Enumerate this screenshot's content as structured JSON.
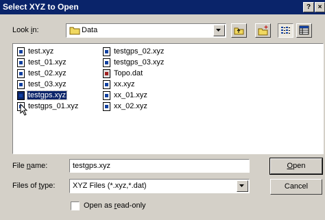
{
  "window": {
    "title": "Select XYZ to Open",
    "help_label": "?",
    "close_label": "×"
  },
  "lookin": {
    "label": "Look in:",
    "folder": "Data"
  },
  "toolbar": {
    "icons": [
      "up-folder-icon",
      "new-folder-icon",
      "list-view-icon",
      "details-view-icon"
    ]
  },
  "files": {
    "col1": [
      {
        "name": "test.xyz",
        "type": "xyz",
        "selected": false
      },
      {
        "name": "test_01.xyz",
        "type": "xyz",
        "selected": false
      },
      {
        "name": "test_02.xyz",
        "type": "xyz",
        "selected": false
      },
      {
        "name": "test_03.xyz",
        "type": "xyz",
        "selected": false
      },
      {
        "name": "testgps.xyz",
        "type": "xyz",
        "selected": true
      },
      {
        "name": "testgps_01.xyz",
        "type": "xyz",
        "selected": false
      }
    ],
    "col2": [
      {
        "name": "testgps_02.xyz",
        "type": "xyz",
        "selected": false
      },
      {
        "name": "testgps_03.xyz",
        "type": "xyz",
        "selected": false
      },
      {
        "name": "Topo.dat",
        "type": "dat",
        "selected": false
      },
      {
        "name": "xx.xyz",
        "type": "xyz",
        "selected": false
      },
      {
        "name": "xx_01.xyz",
        "type": "xyz",
        "selected": false
      },
      {
        "name": "xx_02.xyz",
        "type": "xyz",
        "selected": false
      }
    ]
  },
  "filename": {
    "label": "File name:",
    "value": "testgps.xyz"
  },
  "filetype": {
    "label": "Files of type:",
    "value": "XYZ Files (*.xyz,*.dat)"
  },
  "buttons": {
    "open": "Open",
    "cancel": "Cancel"
  },
  "readonly": {
    "label": "Open as read-only",
    "checked": false
  }
}
